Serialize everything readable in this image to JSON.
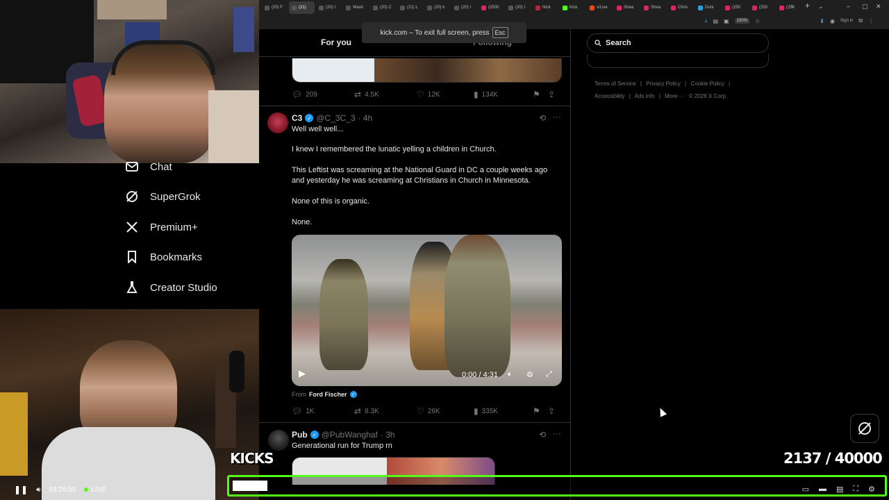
{
  "browser": {
    "tabs": [
      {
        "label": "(20) F",
        "color": "#555"
      },
      {
        "label": "(21)",
        "color": "#555",
        "active": true
      },
      {
        "label": "(20) I",
        "color": "#555"
      },
      {
        "label": "Wash",
        "color": "#555"
      },
      {
        "label": "(20) C",
        "color": "#555"
      },
      {
        "label": "(21) L",
        "color": "#555"
      },
      {
        "label": "(20) k",
        "color": "#555"
      },
      {
        "label": "(20) I",
        "color": "#555"
      },
      {
        "label": "(2500",
        "color": "#e0245e"
      },
      {
        "label": "(20) I",
        "color": "#555"
      },
      {
        "label": "Nick",
        "color": "#c41e3a"
      },
      {
        "label": "Kick",
        "color": "#53fc18"
      },
      {
        "label": "s/Live",
        "color": "#ff4500"
      },
      {
        "label": "Strea",
        "color": "#e0245e"
      },
      {
        "label": "Strea",
        "color": "#e0245e"
      },
      {
        "label": "Chris",
        "color": "#e0245e"
      },
      {
        "label": "Doni",
        "color": "#1da1f2"
      },
      {
        "label": "(250",
        "color": "#e0245e"
      },
      {
        "label": "(250",
        "color": "#e0245e"
      },
      {
        "label": "(250",
        "color": "#e0245e"
      }
    ],
    "zoom": "150%",
    "signin": "Sign in"
  },
  "toast": {
    "text": "kick.com – To exit full screen, press",
    "key": "Esc"
  },
  "feed": {
    "tab_foryou": "For you",
    "tab_following": "Following",
    "prev_stats": {
      "replies": "209",
      "reposts": "4.5K",
      "likes": "12K",
      "views": "134K"
    },
    "post1": {
      "name": "C3",
      "handle": "@C_3C_3",
      "time": "· 4h",
      "lines": [
        "Well well well...",
        "I knew I remembered the lunatic yelling a children in Church.",
        "This Leftist was screaming at the National Guard in DC a couple weeks ago",
        "and yesterday he was screaming at Christians in Church in Minnesota.",
        "None of this is organic.",
        "None."
      ],
      "video_time": "0:00 / 4:31",
      "from_label": "From",
      "from_name": "Ford Fischer",
      "stats": {
        "replies": "1K",
        "reposts": "8.3K",
        "likes": "26K",
        "views": "335K"
      }
    },
    "post2": {
      "name": "Pub",
      "handle": "@PubWanghaf",
      "time": "· 3h",
      "text": "Generational run for Trump rn"
    }
  },
  "sidebar": {
    "items": [
      {
        "label": "Chat",
        "icon": "mail-icon"
      },
      {
        "label": "SuperGrok",
        "icon": "grok-icon"
      },
      {
        "label": "Premium+",
        "icon": "x-logo-icon"
      },
      {
        "label": "Bookmarks",
        "icon": "bookmark-icon"
      },
      {
        "label": "Creator Studio",
        "icon": "flask-icon"
      }
    ]
  },
  "right": {
    "search_placeholder": "Search",
    "footer": [
      "Terms of Service",
      "|",
      "Privacy Policy",
      "|",
      "Cookie Policy",
      "|",
      "Accessibility",
      "|",
      "Ads info",
      "|",
      "More ···",
      "© 2026 X Corp."
    ]
  },
  "overlay": {
    "kicks_label": "KICKS",
    "kicks_count": "2137  / 40000",
    "kicks_progress": 0.053,
    "accent": "#53fc18"
  },
  "player": {
    "time": "03:26:55",
    "live": "LIVE"
  }
}
